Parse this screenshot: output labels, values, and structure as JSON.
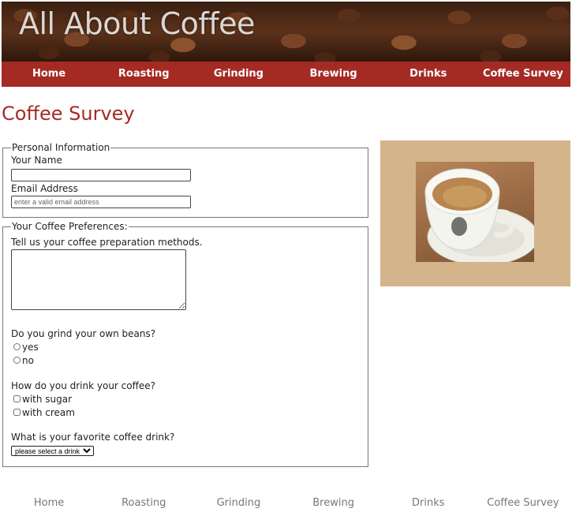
{
  "header": {
    "title": "All About Coffee"
  },
  "nav": [
    "Home",
    "Roasting",
    "Grinding",
    "Brewing",
    "Drinks",
    "Coffee Survey"
  ],
  "page_title": "Coffee Survey",
  "personal": {
    "legend": "Personal Information",
    "name_label": "Your Name",
    "name_value": "",
    "email_label": "Email Address",
    "email_placeholder": "enter a valid email address"
  },
  "prefs": {
    "legend": "Your Coffee Preferences:",
    "methods_label": "Tell us your coffee preparation methods.",
    "grind_question": "Do you grind your own beans?",
    "grind_options": [
      "yes",
      "no"
    ],
    "drink_question": "How do you drink your coffee?",
    "drink_options": [
      "with sugar",
      "with cream"
    ],
    "favorite_question": "What is your favorite coffee drink?",
    "favorite_selected": "please select a drink"
  },
  "colors": {
    "accent": "#a52a24",
    "photo_bg": "#d4b48a"
  },
  "footer_nav": [
    "Home",
    "Roasting",
    "Grinding",
    "Brewing",
    "Drinks",
    "Coffee Survey"
  ]
}
